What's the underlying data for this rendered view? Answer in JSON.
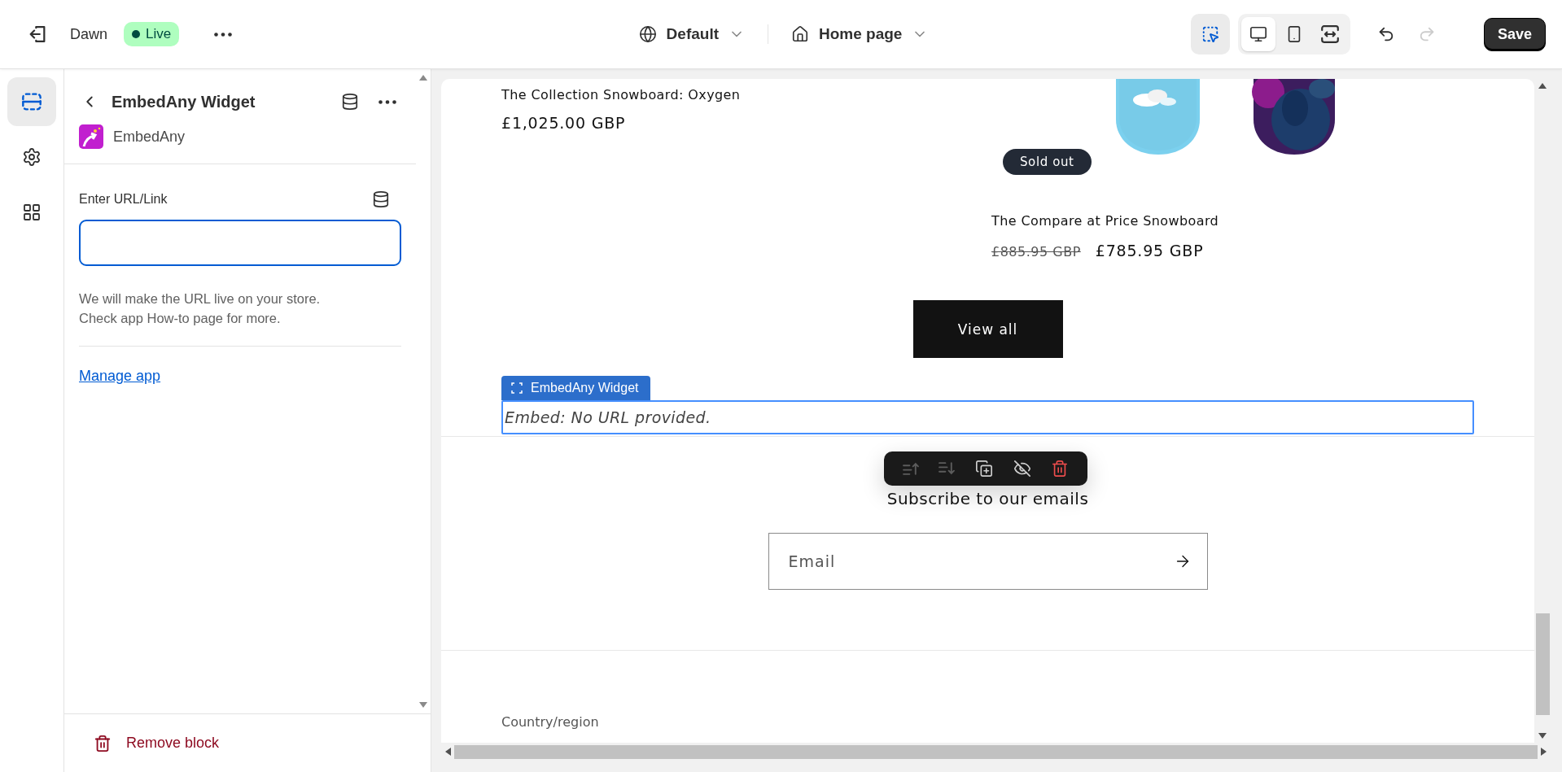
{
  "topbar": {
    "theme_name": "Dawn",
    "status": {
      "label": "Live",
      "live": true
    },
    "language": "Default",
    "template": "Home page",
    "inspector": {
      "selected": true
    },
    "devices": [
      {
        "kind": "desktop",
        "selected": true
      },
      {
        "kind": "mobile",
        "selected": false
      },
      {
        "kind": "fullwidth",
        "selected": false
      }
    ],
    "undo": {
      "disabled": false
    },
    "redo": {
      "disabled": true
    },
    "save": "Save"
  },
  "rail": [
    {
      "kind": "sections",
      "selected": true
    },
    {
      "kind": "settings",
      "selected": false
    },
    {
      "kind": "apps",
      "selected": false
    }
  ],
  "panel": {
    "title": "EmbedAny Widget",
    "app_name": "EmbedAny",
    "field_label": "Enter URL/Link",
    "help_lines": [
      "We will make the URL live on your store.",
      "Check app How-to page for more."
    ],
    "link": "Manage app",
    "remove": "Remove block"
  },
  "preview": {
    "products": [
      {
        "title": "The Collection Snowboard: Oxygen",
        "price": "£1,025.00 GBP"
      },
      {
        "title": "The Compare at Price Snowboard",
        "compare_price": "£885.95 GBP",
        "price": "£785.95 GBP",
        "sold_out": true,
        "badge": "Sold out"
      }
    ],
    "button": "View all",
    "widget_tag": "EmbedAny Widget",
    "embed_message": "Embed: No URL provided.",
    "block_toolbar": [
      {
        "kind": "move_up",
        "disabled": true
      },
      {
        "kind": "move_down",
        "disabled": true
      },
      {
        "kind": "duplicate",
        "disabled": false
      },
      {
        "kind": "hide",
        "disabled": false
      },
      {
        "kind": "delete",
        "disabled": false
      }
    ],
    "newsletter_heading": "Subscribe to our emails",
    "email_placeholder": "Email",
    "footer_label": "Country/region"
  }
}
